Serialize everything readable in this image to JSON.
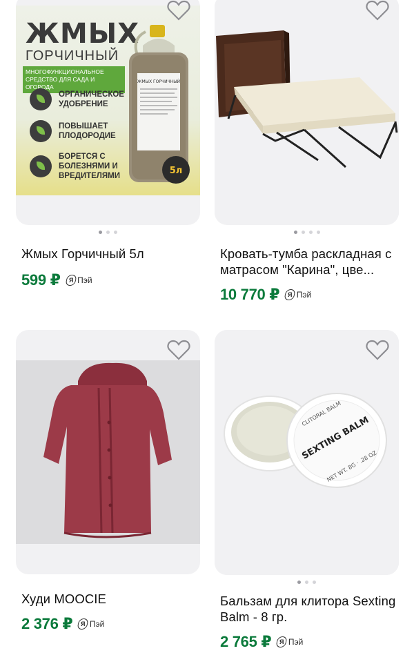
{
  "colors": {
    "price": "#0b7a3b",
    "card_bg": "#f1f1f3"
  },
  "products": [
    {
      "title": "Жмых Горчичный 5л",
      "price": "599 ₽",
      "pay_label": "Пэй",
      "pay_badge": "Я",
      "image": {
        "heading": "ЖМЫХ",
        "subheading": "ГОРЧИЧНЫЙ",
        "band_text": "МНОГОФУНКЦИОНАЛЬНОЕ СРЕДСТВО ДЛЯ САДА И ОГОРОДА",
        "features": [
          "ОРГАНИЧЕСКОЕ УДОБРЕНИЕ",
          "ПОВЫШАЕТ ПЛОДОРОДИЕ",
          "БОРЕТСЯ С БОЛЕЗНЯМИ И ВРЕДИТЕЛЯМИ"
        ],
        "label_title": "ЖМЫХ ГОРЧИЧНЫЙ",
        "volume": "5л"
      },
      "dots": 3,
      "active_dot": 0
    },
    {
      "title": "Кровать-тумба раскладная с матрасом \"Карина\", цве...",
      "price": "10 770 ₽",
      "pay_label": "Пэй",
      "pay_badge": "Я",
      "dots": 4,
      "active_dot": 0
    },
    {
      "title": "Худи MOOCIE",
      "price": "2 376 ₽",
      "pay_label": "Пэй",
      "pay_badge": "Я"
    },
    {
      "title": "Бальзам для клитора Sexting Balm - 8 гр.",
      "price": "2 765 ₽",
      "pay_label": "Пэй",
      "pay_badge": "Я",
      "image": {
        "lid_top": "CLITORAL BALM",
        "lid_main": "SEXTING BALM",
        "lid_bottom": "NET WT. 8G · .28 OZ"
      },
      "dots": 3,
      "active_dot": 0
    }
  ]
}
